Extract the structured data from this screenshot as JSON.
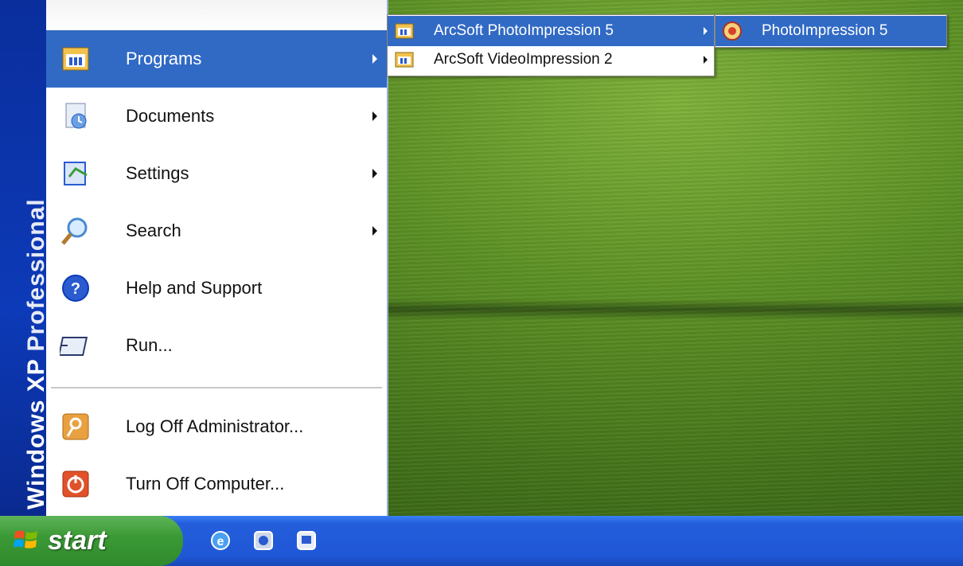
{
  "sidebar": {
    "brand": "Windows XP",
    "edition": "Professional"
  },
  "start_menu": {
    "items": [
      {
        "label": "Programs",
        "icon": "programs-icon",
        "has_submenu": true,
        "active": true
      },
      {
        "label": "Documents",
        "icon": "documents-icon",
        "has_submenu": true
      },
      {
        "label": "Settings",
        "icon": "settings-icon",
        "has_submenu": true
      },
      {
        "label": "Search",
        "icon": "search-icon",
        "has_submenu": true
      },
      {
        "label": "Help and Support",
        "icon": "help-icon",
        "has_submenu": false
      },
      {
        "label": "Run...",
        "icon": "run-icon",
        "has_submenu": false
      }
    ],
    "bottom_items": [
      {
        "label": "Log Off Administrator...",
        "icon": "log-off-icon"
      },
      {
        "label": "Turn Off Computer...",
        "icon": "power-icon"
      }
    ]
  },
  "programs_submenu": {
    "items": [
      {
        "label": "ArcSoft PhotoImpression 5",
        "icon": "program-group-icon",
        "has_submenu": true,
        "active": true
      },
      {
        "label": "ArcSoft VideoImpression 2",
        "icon": "program-group-icon",
        "has_submenu": true
      }
    ]
  },
  "photoimpression_submenu": {
    "items": [
      {
        "label": "PhotoImpression 5",
        "icon": "photoimpression-app-icon",
        "active": true
      }
    ]
  },
  "taskbar": {
    "start_label": "start",
    "quick_launch": [
      "internet-explorer-icon",
      "media-player-icon",
      "show-desktop-icon"
    ]
  },
  "colors": {
    "highlight": "#316ac5",
    "sidebar_blue": "#0d3ab8",
    "taskbar_blue": "#245edb",
    "start_green": "#3c9a36"
  }
}
